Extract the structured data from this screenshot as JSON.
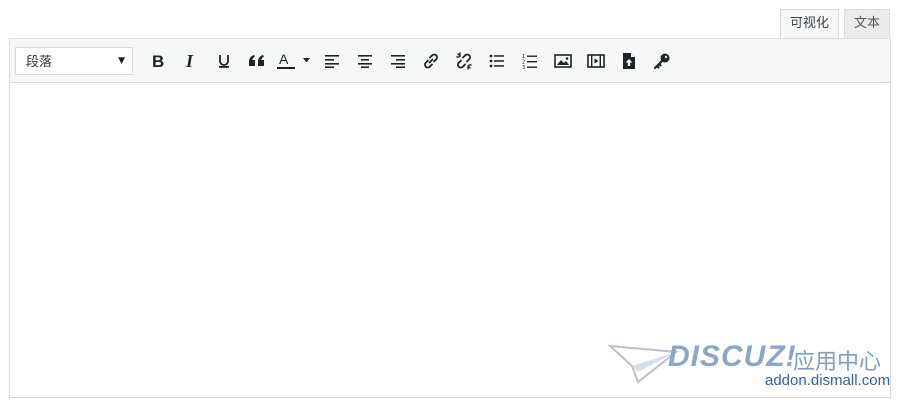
{
  "tabs": [
    {
      "label": "可视化",
      "active": true
    },
    {
      "label": "文本",
      "active": false
    }
  ],
  "toolbar": {
    "format_select": {
      "value": "段落"
    },
    "buttons": [
      {
        "name": "bold",
        "icon": "bold-icon"
      },
      {
        "name": "italic",
        "icon": "italic-icon"
      },
      {
        "name": "underline",
        "icon": "underline-icon"
      },
      {
        "name": "blockquote",
        "icon": "quote-icon"
      },
      {
        "name": "text-color",
        "icon": "text-color-icon"
      },
      {
        "name": "align-left",
        "icon": "align-left-icon"
      },
      {
        "name": "align-center",
        "icon": "align-center-icon"
      },
      {
        "name": "align-right",
        "icon": "align-right-icon"
      },
      {
        "name": "insert-link",
        "icon": "link-icon"
      },
      {
        "name": "remove-link",
        "icon": "unlink-icon"
      },
      {
        "name": "bullet-list",
        "icon": "bullet-list-icon"
      },
      {
        "name": "numbered-list",
        "icon": "numbered-list-icon"
      },
      {
        "name": "insert-image",
        "icon": "image-icon"
      },
      {
        "name": "insert-video",
        "icon": "video-icon"
      },
      {
        "name": "upload-file",
        "icon": "file-upload-icon"
      },
      {
        "name": "key",
        "icon": "key-icon"
      }
    ]
  },
  "editor": {
    "content": ""
  },
  "watermark": {
    "logo_text": "DISCUZ!",
    "cn_text": "应用中心",
    "url": "addon.dismall.com"
  },
  "colors": {
    "toolbar_bg": "#f6f7f7",
    "border": "#dcdcde",
    "icon": "#1d2327",
    "watermark_blue": "#2f63a4"
  }
}
